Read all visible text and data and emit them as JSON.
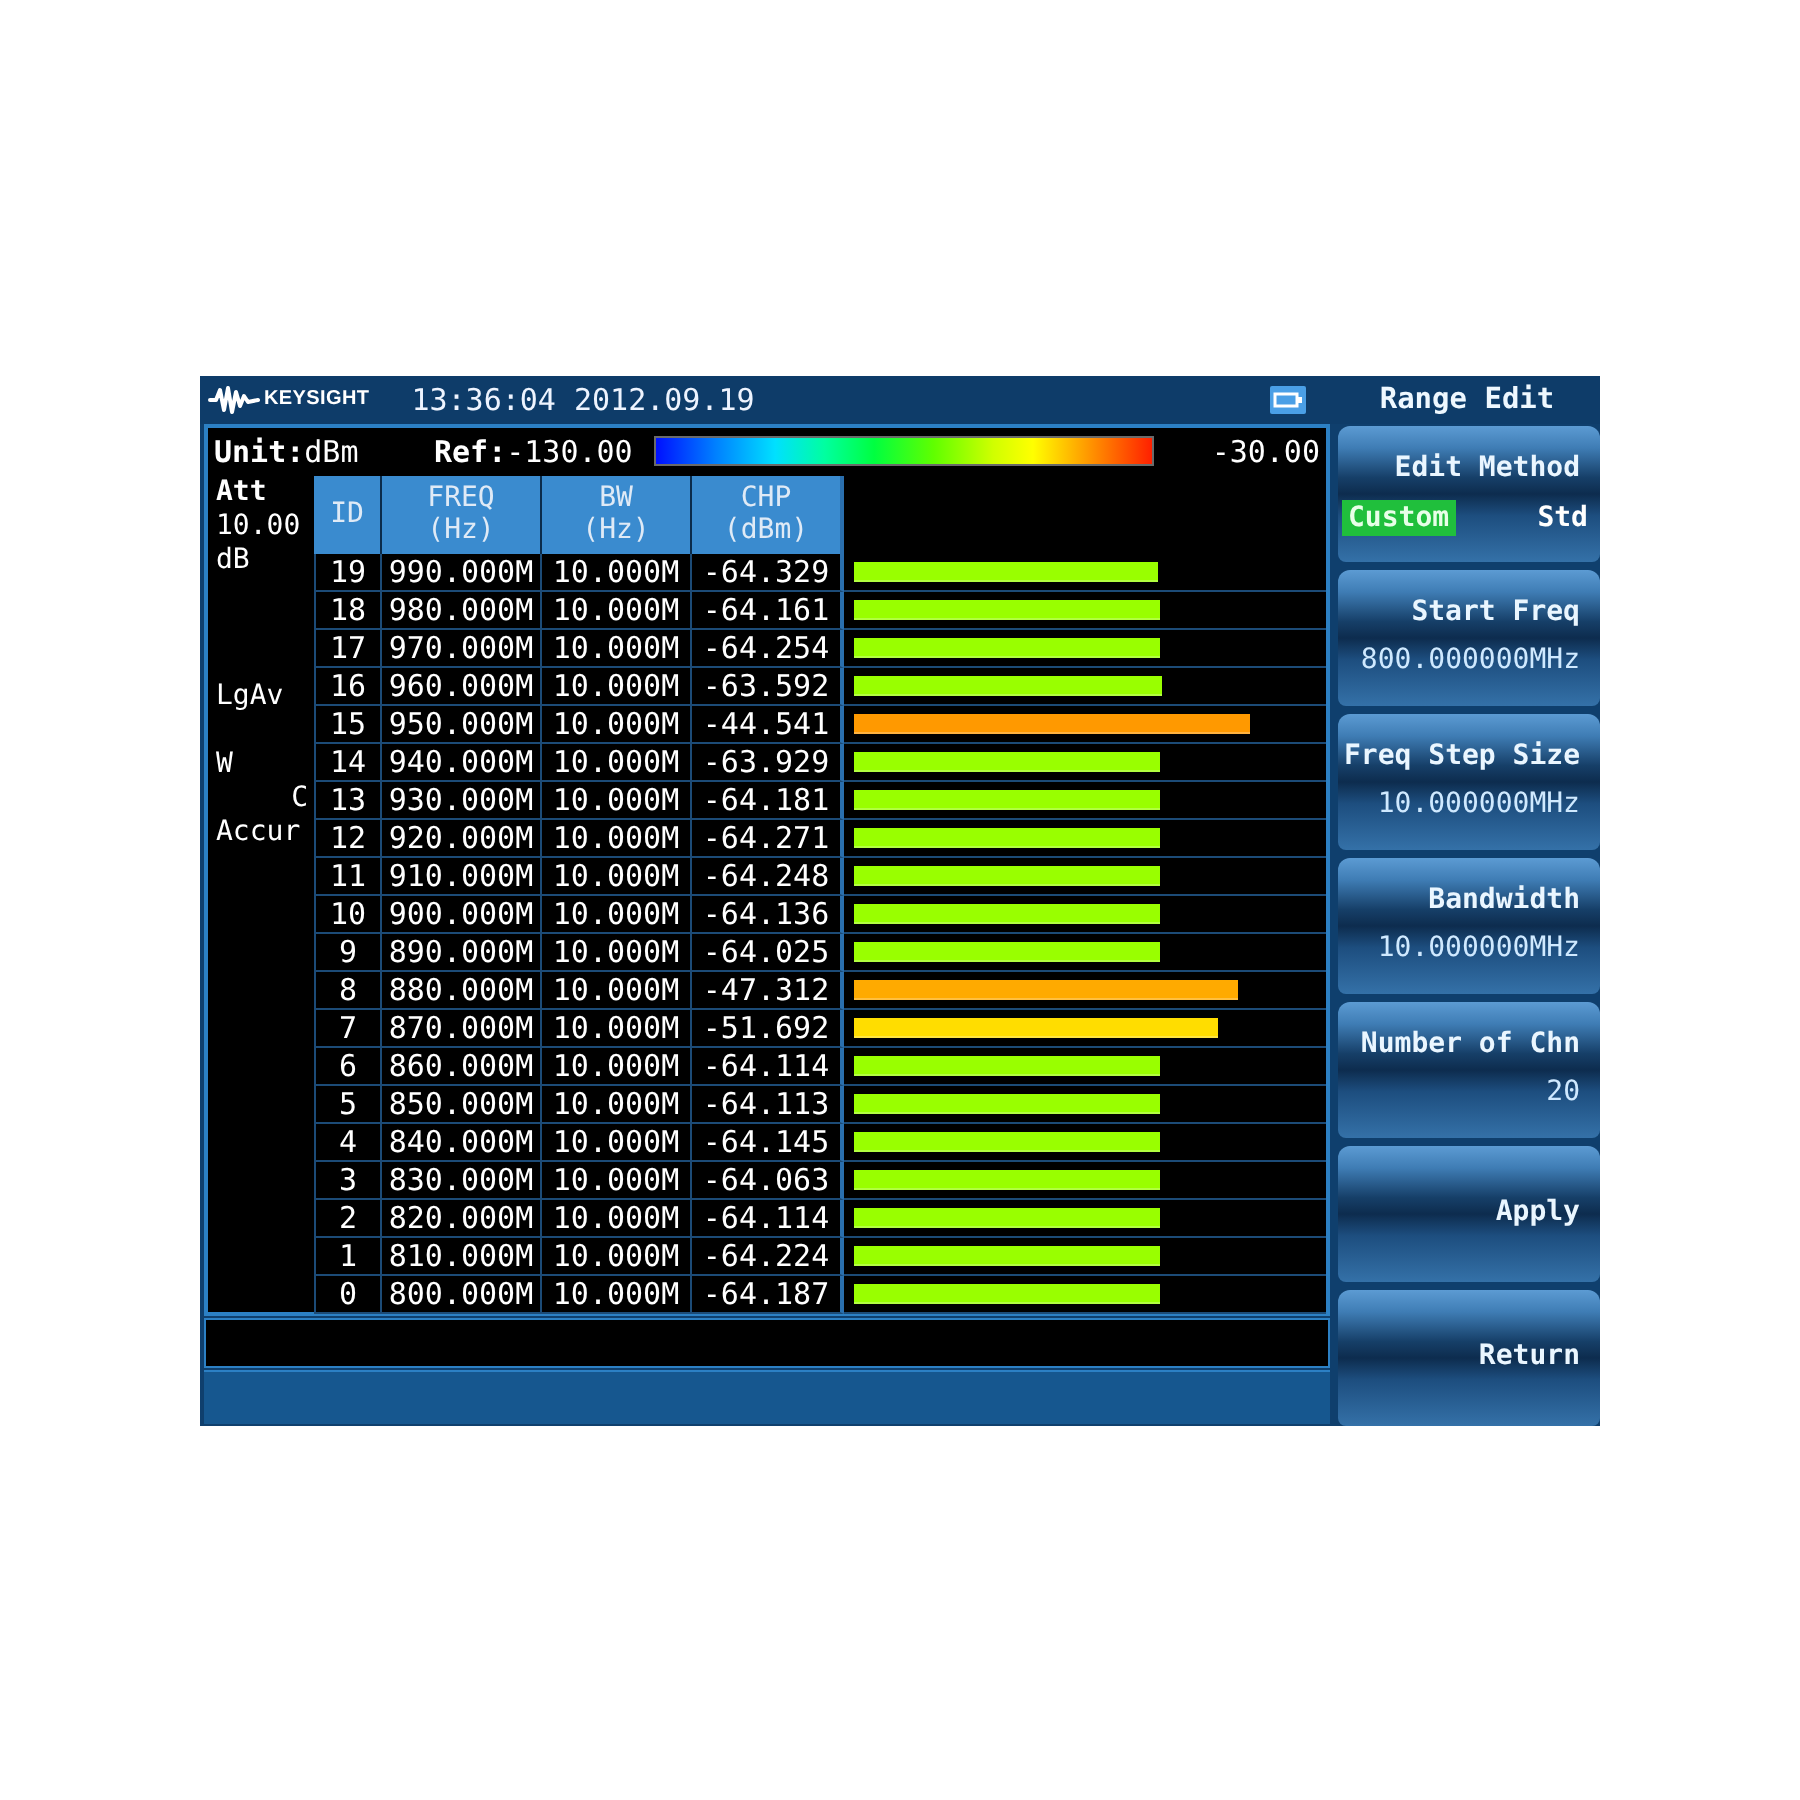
{
  "header": {
    "logo": "KEYSIGHT",
    "datetime": "13:36:04 2012.09.19"
  },
  "display": {
    "unit": "**Unit:**dBm",
    "ref": "**Ref:**-130.00",
    "scale_max": "-30.00"
  },
  "side_panel": {
    "att_label": "Att",
    "att_value": "10.00",
    "att_unit": "dB",
    "detector": "LgAv",
    "indicators": [
      "W",
      "C",
      "Accur"
    ]
  },
  "table": {
    "columns": [
      {
        "title": "ID"
      },
      {
        "title": "FREQ",
        "unit": "(Hz)"
      },
      {
        "title": "BW",
        "unit": "(Hz)"
      },
      {
        "title": "CHP",
        "unit": "(dBm)"
      }
    ],
    "rows": [
      {
        "id": "19",
        "freq": "990.000M",
        "bw": "10.000M",
        "chp": "-64.329",
        "level": 0.632,
        "color": "#99ff00"
      },
      {
        "id": "18",
        "freq": "980.000M",
        "bw": "10.000M",
        "chp": "-64.161",
        "level": 0.634,
        "color": "#99ff00"
      },
      {
        "id": "17",
        "freq": "970.000M",
        "bw": "10.000M",
        "chp": "-64.254",
        "level": 0.633,
        "color": "#99ff00"
      },
      {
        "id": "16",
        "freq": "960.000M",
        "bw": "10.000M",
        "chp": "-63.592",
        "level": 0.639,
        "color": "#99ff00"
      },
      {
        "id": "15",
        "freq": "950.000M",
        "bw": "10.000M",
        "chp": "-44.541",
        "level": 0.823,
        "color": "#ff9900"
      },
      {
        "id": "14",
        "freq": "940.000M",
        "bw": "10.000M",
        "chp": "-63.929",
        "level": 0.636,
        "color": "#99ff00"
      },
      {
        "id": "13",
        "freq": "930.000M",
        "bw": "10.000M",
        "chp": "-64.181",
        "level": 0.634,
        "color": "#99ff00"
      },
      {
        "id": "12",
        "freq": "920.000M",
        "bw": "10.000M",
        "chp": "-64.271",
        "level": 0.633,
        "color": "#99ff00"
      },
      {
        "id": "11",
        "freq": "910.000M",
        "bw": "10.000M",
        "chp": "-64.248",
        "level": 0.633,
        "color": "#99ff00"
      },
      {
        "id": "10",
        "freq": "900.000M",
        "bw": "10.000M",
        "chp": "-64.136",
        "level": 0.634,
        "color": "#99ff00"
      },
      {
        "id": "9",
        "freq": "890.000M",
        "bw": "10.000M",
        "chp": "-64.025",
        "level": 0.635,
        "color": "#99ff00"
      },
      {
        "id": "8",
        "freq": "880.000M",
        "bw": "10.000M",
        "chp": "-47.312",
        "level": 0.796,
        "color": "#ffaa00"
      },
      {
        "id": "7",
        "freq": "870.000M",
        "bw": "10.000M",
        "chp": "-51.692",
        "level": 0.754,
        "color": "#ffdd00"
      },
      {
        "id": "6",
        "freq": "860.000M",
        "bw": "10.000M",
        "chp": "-64.114",
        "level": 0.634,
        "color": "#99ff00"
      },
      {
        "id": "5",
        "freq": "850.000M",
        "bw": "10.000M",
        "chp": "-64.113",
        "level": 0.634,
        "color": "#99ff00"
      },
      {
        "id": "4",
        "freq": "840.000M",
        "bw": "10.000M",
        "chp": "-64.145",
        "level": 0.634,
        "color": "#99ff00"
      },
      {
        "id": "3",
        "freq": "830.000M",
        "bw": "10.000M",
        "chp": "-64.063",
        "level": 0.635,
        "color": "#99ff00"
      },
      {
        "id": "2",
        "freq": "820.000M",
        "bw": "10.000M",
        "chp": "-64.114",
        "level": 0.634,
        "color": "#99ff00"
      },
      {
        "id": "1",
        "freq": "810.000M",
        "bw": "10.000M",
        "chp": "-64.224",
        "level": 0.633,
        "color": "#99ff00"
      },
      {
        "id": "0",
        "freq": "800.000M",
        "bw": "10.000M",
        "chp": "-64.187",
        "level": 0.634,
        "color": "#99ff00"
      }
    ]
  },
  "menu": {
    "title": "Range Edit",
    "softkeys": [
      {
        "kind": "choice",
        "label": "Edit Method",
        "options": [
          {
            "label": "Custom",
            "selected": true
          },
          {
            "label": "Std",
            "selected": false
          }
        ]
      },
      {
        "kind": "value",
        "label": "Start Freq",
        "value": "800.000000MHz"
      },
      {
        "kind": "value",
        "label": "Freq Step Size",
        "value": "10.000000MHz"
      },
      {
        "kind": "value",
        "label": "Bandwidth",
        "value": "10.000000MHz"
      },
      {
        "kind": "value",
        "label": "Number of Chn",
        "value": "20"
      },
      {
        "kind": "action",
        "label": "Apply"
      },
      {
        "kind": "action",
        "label": "Return"
      }
    ]
  }
}
